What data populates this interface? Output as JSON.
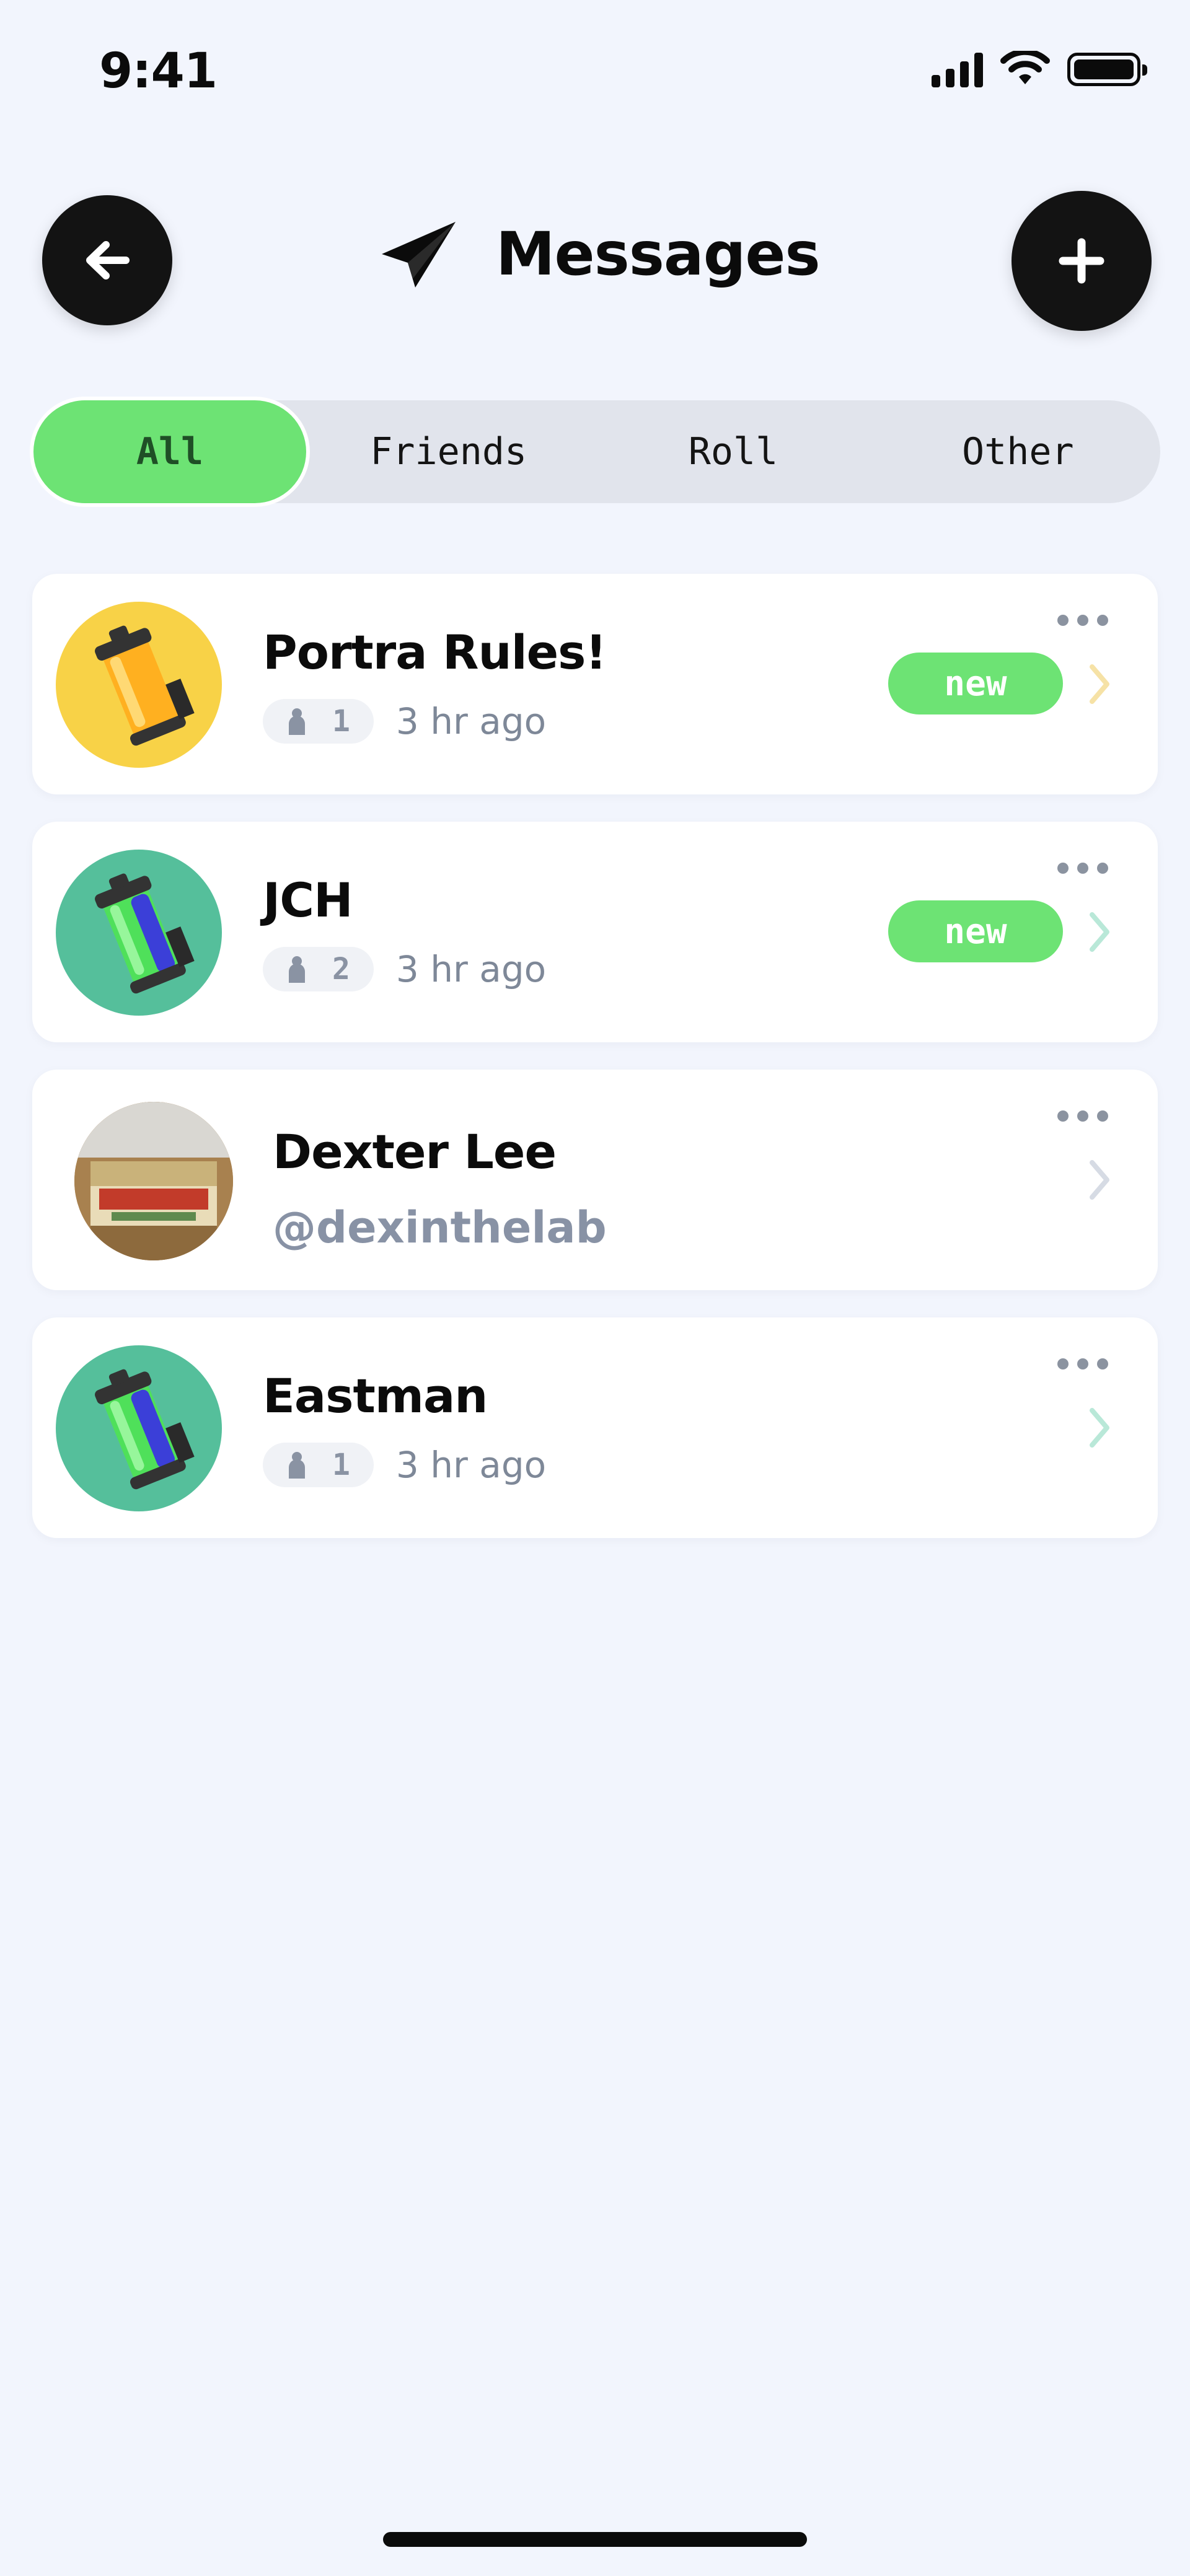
{
  "status_bar": {
    "time": "9:41"
  },
  "header": {
    "title": "Messages"
  },
  "tabs": [
    {
      "label": "All",
      "active": true
    },
    {
      "label": "Friends",
      "active": false
    },
    {
      "label": "Roll",
      "active": false
    },
    {
      "label": "Other",
      "active": false
    }
  ],
  "conversations": [
    {
      "name": "Portra Rules!",
      "member_count": "1",
      "time_ago": "3 hr ago",
      "badge": "new",
      "avatar": "yellow-film-canister",
      "avatar_bg": "#f8d247",
      "chevron_color": "#f6e2a6"
    },
    {
      "name": "JCH",
      "member_count": "2",
      "time_ago": "3 hr ago",
      "badge": "new",
      "avatar": "green-film-canister",
      "avatar_bg": "#55bf9b",
      "chevron_color": "#b9e8d8"
    },
    {
      "name": "Dexter Lee",
      "handle": "@dexinthelab",
      "avatar": "butter-photo",
      "chevron_color": "#d6dbe4"
    },
    {
      "name": "Eastman",
      "member_count": "1",
      "time_ago": "3 hr ago",
      "avatar": "green-film-canister",
      "avatar_bg": "#55bf9b",
      "chevron_color": "#b9e8d8"
    }
  ],
  "colors": {
    "accent_green": "#6de374",
    "background": "#f2f5fd"
  },
  "icons": {
    "back": "arrow-left-icon",
    "add": "plus-icon",
    "title": "paper-plane-icon",
    "more": "ellipsis-icon",
    "chevron": "chevron-right-icon",
    "members": "person-icon"
  }
}
